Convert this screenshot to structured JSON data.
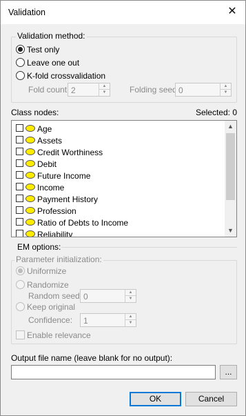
{
  "window": {
    "title": "Validation",
    "close_glyph": "✕"
  },
  "validation_method": {
    "legend": "Validation method:",
    "options": [
      {
        "label": "Test only",
        "selected": true
      },
      {
        "label": "Leave one out",
        "selected": false
      },
      {
        "label": "K-fold crossvalidation",
        "selected": false
      }
    ],
    "fold_count_label": "Fold count:",
    "fold_count_value": "2",
    "folding_seed_label": "Folding seed:",
    "folding_seed_value": "0"
  },
  "class_nodes": {
    "label": "Class nodes:",
    "selected_text": "Selected: 0",
    "items": [
      {
        "label": "Age"
      },
      {
        "label": "Assets"
      },
      {
        "label": "Credit Worthiness"
      },
      {
        "label": "Debit"
      },
      {
        "label": "Future Income"
      },
      {
        "label": "Income"
      },
      {
        "label": "Payment History"
      },
      {
        "label": "Profession"
      },
      {
        "label": "Ratio of Debts to Income"
      },
      {
        "label": "Reliability"
      }
    ],
    "node_color": "#ffec00"
  },
  "em_options": {
    "legend": "EM options:",
    "param_init_label": "Parameter initialization:",
    "uniformize_label": "Uniformize",
    "randomize_label": "Randomize",
    "random_seed_label": "Random seed:",
    "random_seed_value": "0",
    "keep_original_label": "Keep original",
    "confidence_label": "Confidence:",
    "confidence_value": "1",
    "enable_relevance_label": "Enable relevance"
  },
  "output": {
    "label": "Output file name (leave blank for no output):",
    "value": "",
    "browse_label": "..."
  },
  "buttons": {
    "ok": "OK",
    "cancel": "Cancel"
  },
  "colors": {
    "accent": "#0078d7"
  }
}
